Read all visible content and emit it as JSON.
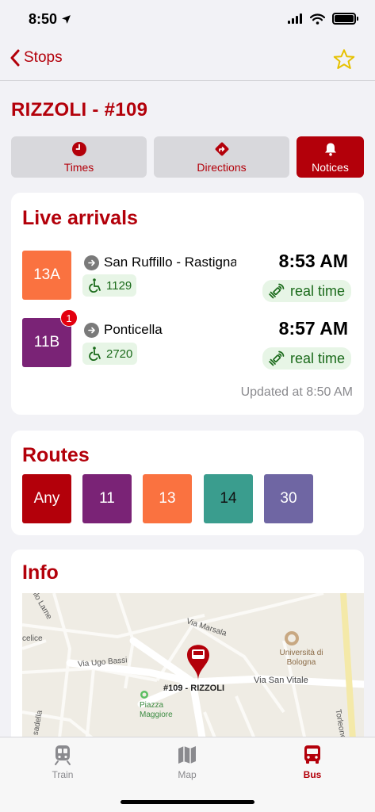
{
  "status": {
    "time": "8:50"
  },
  "nav": {
    "back_label": "Stops"
  },
  "stop": {
    "title": "RIZZOLI - #109"
  },
  "segments": [
    {
      "label": "Times"
    },
    {
      "label": "Directions"
    },
    {
      "label": "Notices"
    }
  ],
  "live": {
    "title": "Live arrivals",
    "arrivals": [
      {
        "line": "13A",
        "color": "#fa7240",
        "destination": "San Ruffillo - Rastignano",
        "vehicle": "1129",
        "time": "8:53 AM",
        "status": "real time",
        "notices": ""
      },
      {
        "line": "11B",
        "color": "#7a2376",
        "destination": "Ponticella",
        "vehicle": "2720",
        "time": "8:57 AM",
        "status": "real time",
        "notices": "1"
      }
    ],
    "updated": "Updated at 8:50 AM"
  },
  "routes": {
    "title": "Routes",
    "items": [
      {
        "label": "Any",
        "color": "#b3000a"
      },
      {
        "label": "11",
        "color": "#7a2376"
      },
      {
        "label": "13",
        "color": "#fa7240"
      },
      {
        "label": "14",
        "color": "#3a9d8e"
      },
      {
        "label": "30",
        "color": "#6f66a3"
      }
    ]
  },
  "info": {
    "title": "Info",
    "map": {
      "stop_label": "#109 - RIZZOLI",
      "streets": [
        "Via Marsala",
        "Via Ugo Bassi",
        "Via San Vitale",
        "ello Lame",
        "celice",
        "sadella",
        "Torleone"
      ],
      "poi_university": "Università di Bologna",
      "poi_piazza": "Piazza Maggiore"
    }
  },
  "tabs": [
    {
      "label": "Train"
    },
    {
      "label": "Map"
    },
    {
      "label": "Bus"
    }
  ],
  "colors": {
    "accent": "#b3000a",
    "realtime_bg": "#e7f5e6",
    "realtime_text": "#1a6a1a"
  }
}
